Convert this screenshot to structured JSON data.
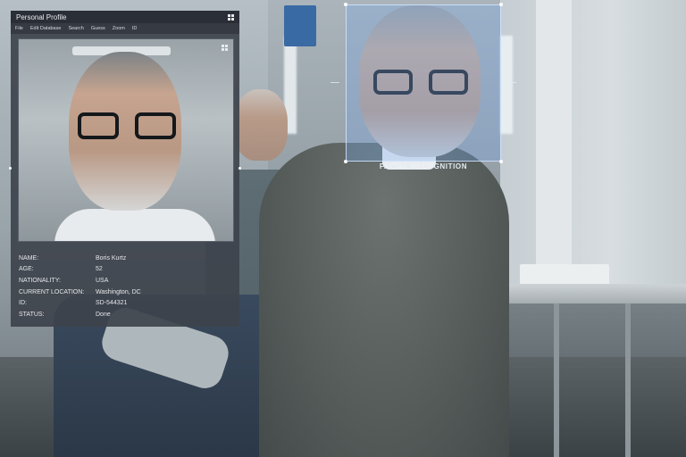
{
  "window": {
    "title": "Personal Profile",
    "menu": [
      "File",
      "Edit Database",
      "Search",
      "Guess",
      "Zoom",
      "ID"
    ]
  },
  "profile": {
    "fields": [
      {
        "label": "NAME:",
        "value": "Boris Kurtz"
      },
      {
        "label": "AGE:",
        "value": "52"
      },
      {
        "label": "NATIONALITY:",
        "value": "USA"
      },
      {
        "label": "CURRENT LOCATION:",
        "value": "Washington, DC"
      },
      {
        "label": "ID:",
        "value": "SD-544321"
      },
      {
        "label": "STATUS:",
        "value": "Done"
      }
    ]
  },
  "recognition": {
    "label": "FACIAL RECOGNITION",
    "box_color": "#78aaf0"
  },
  "icons": {
    "window_menu": "grid-icon",
    "photo_menu": "grid-icon"
  }
}
